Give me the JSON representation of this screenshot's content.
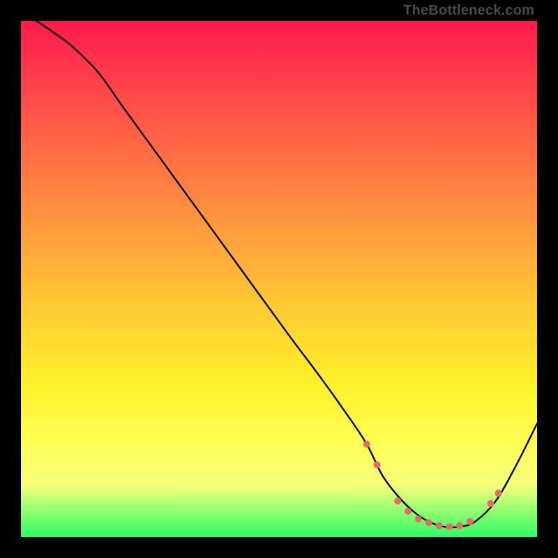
{
  "attribution": "TheBottleneck.com",
  "colors": {
    "background": "#000000",
    "gradient_top": "#ff1a4d",
    "gradient_bottom": "#2bff66",
    "curve": "#000000",
    "marker": "#e66a6a"
  },
  "chart_data": {
    "type": "line",
    "title": "",
    "xlabel": "",
    "ylabel": "",
    "xlim": [
      0,
      100
    ],
    "ylim": [
      0,
      100
    ],
    "x": [
      3,
      6,
      10,
      15,
      20,
      28,
      36,
      44,
      52,
      58,
      63,
      67,
      70,
      73,
      76,
      79,
      82,
      85,
      88,
      92,
      96,
      100
    ],
    "values": [
      100,
      98,
      95,
      90,
      83,
      72,
      61,
      50,
      39,
      31,
      24,
      18,
      12,
      8,
      5,
      3,
      2,
      2,
      3,
      7,
      14,
      22
    ],
    "series": [
      {
        "name": "bottleneck-curve",
        "x": [
          3,
          6,
          10,
          15,
          20,
          28,
          36,
          44,
          52,
          58,
          63,
          67,
          70,
          73,
          76,
          79,
          82,
          85,
          88,
          92,
          96,
          100
        ],
        "y": [
          100,
          98,
          95,
          90,
          83,
          72,
          61,
          50,
          39,
          31,
          24,
          18,
          12,
          8,
          5,
          3,
          2,
          2,
          3,
          7,
          14,
          22
        ]
      }
    ],
    "markers": [
      {
        "x": 67,
        "y": 18
      },
      {
        "x": 69,
        "y": 14
      },
      {
        "x": 73,
        "y": 7
      },
      {
        "x": 75,
        "y": 5
      },
      {
        "x": 77,
        "y": 3.5
      },
      {
        "x": 79,
        "y": 2.8
      },
      {
        "x": 81,
        "y": 2.2
      },
      {
        "x": 83,
        "y": 2
      },
      {
        "x": 85,
        "y": 2.2
      },
      {
        "x": 87,
        "y": 3
      },
      {
        "x": 91,
        "y": 6.5
      },
      {
        "x": 92.5,
        "y": 8.5
      }
    ]
  }
}
